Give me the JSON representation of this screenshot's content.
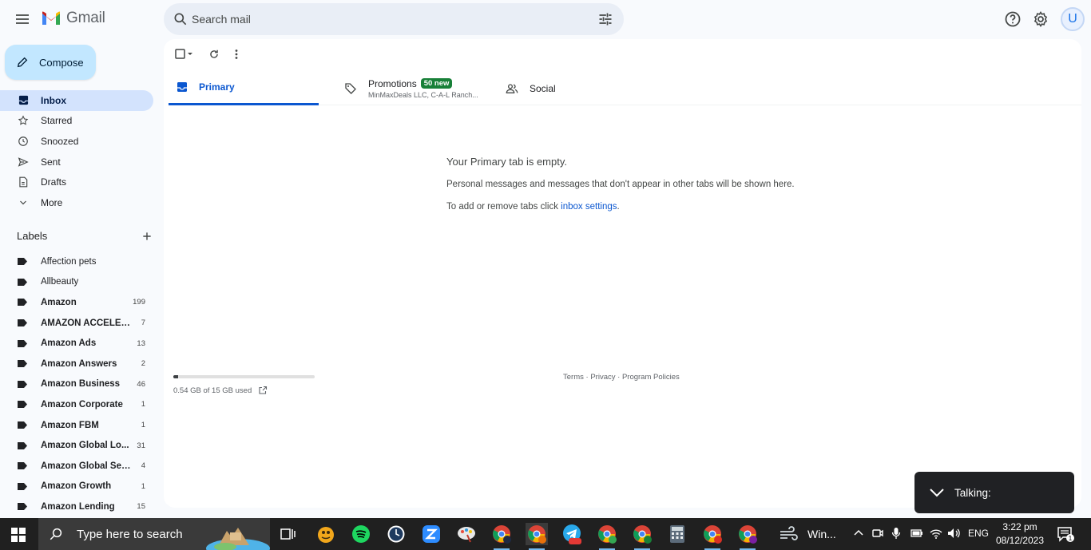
{
  "app": {
    "name": "Gmail"
  },
  "search": {
    "placeholder": "Search mail"
  },
  "compose": {
    "label": "Compose"
  },
  "nav": [
    {
      "label": "Inbox",
      "icon": "inbox-icon",
      "active": true
    },
    {
      "label": "Starred",
      "icon": "star-icon"
    },
    {
      "label": "Snoozed",
      "icon": "clock-icon"
    },
    {
      "label": "Sent",
      "icon": "send-icon"
    },
    {
      "label": "Drafts",
      "icon": "draft-icon"
    },
    {
      "label": "More",
      "icon": "chevron-down-icon"
    }
  ],
  "labels": {
    "title": "Labels",
    "items": [
      {
        "name": "Affection pets",
        "count": "",
        "bold": false
      },
      {
        "name": "Allbeauty",
        "count": "",
        "bold": false
      },
      {
        "name": "Amazon",
        "count": "199",
        "bold": true
      },
      {
        "name": "AMAZON ACCELER...",
        "count": "7",
        "bold": true
      },
      {
        "name": "Amazon Ads",
        "count": "13",
        "bold": true
      },
      {
        "name": "Amazon Answers",
        "count": "2",
        "bold": true
      },
      {
        "name": "Amazon Business",
        "count": "46",
        "bold": true
      },
      {
        "name": "Amazon Corporate",
        "count": "1",
        "bold": true
      },
      {
        "name": "Amazon FBM",
        "count": "1",
        "bold": true
      },
      {
        "name": "Amazon Global Lo...",
        "count": "31",
        "bold": true
      },
      {
        "name": "Amazon Global Sell...",
        "count": "4",
        "bold": true
      },
      {
        "name": "Amazon Growth",
        "count": "1",
        "bold": true
      },
      {
        "name": "Amazon Lending",
        "count": "15",
        "bold": true
      }
    ]
  },
  "tabs": {
    "primary": "Primary",
    "promotions": "Promotions",
    "promotions_badge": "50 new",
    "promotions_senders": "MinMaxDeals LLC, C-A-L Ranch...",
    "social": "Social"
  },
  "empty": {
    "title": "Your Primary tab is empty.",
    "line1": "Personal messages and messages that don't appear in other tabs will be shown here.",
    "line2_prefix": "To add or remove tabs click ",
    "line2_link": "inbox settings",
    "line2_suffix": "."
  },
  "storage": {
    "text": "0.54 GB of 15 GB used",
    "fraction": 0.036
  },
  "footer": {
    "terms": "Terms",
    "privacy": "Privacy",
    "policies": "Program Policies",
    "sep": " · "
  },
  "avatar": {
    "initial": "U"
  },
  "talking": {
    "label": "Talking:"
  },
  "taskbar": {
    "search_placeholder": "Type here to search",
    "window_label": "Win...",
    "lang": "ENG",
    "time": "3:22 pm",
    "date": "08/12/2023",
    "notif_count": "1",
    "telegram_badge": "989"
  },
  "colors": {
    "accent": "#0b57d0",
    "compose": "#c2e7ff",
    "active_nav": "#d3e3fd",
    "badge": "#188038"
  }
}
